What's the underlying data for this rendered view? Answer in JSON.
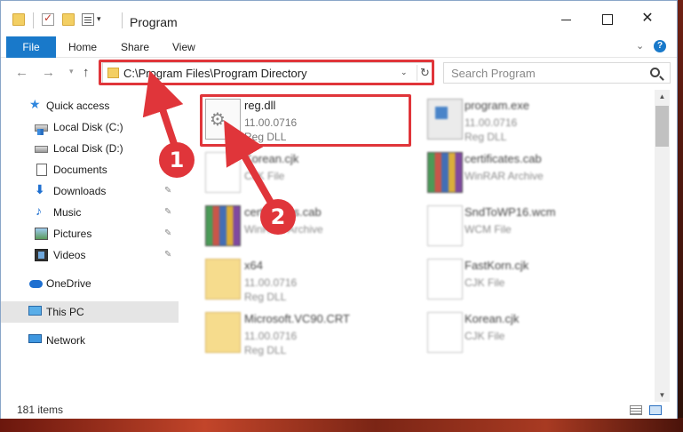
{
  "window": {
    "title": "Program",
    "minimize_glyph": "",
    "close_glyph": "✕"
  },
  "ribbon": {
    "tabs": [
      "File",
      "Home",
      "Share",
      "View"
    ],
    "collapse_glyph": "⌄",
    "help_glyph": "?"
  },
  "nav": {
    "back_glyph": "←",
    "forward_glyph": "→",
    "up_glyph": "↑",
    "recent_glyph": "▾"
  },
  "address": {
    "path": "C:\\Program Files\\Program Directory",
    "dropdown_glyph": "⌄",
    "refresh_glyph": "↻"
  },
  "search": {
    "placeholder": "Search Program"
  },
  "sidebar": {
    "items": [
      {
        "label": "Quick access",
        "icon": "star-icon"
      },
      {
        "label": "Local Disk (C:)",
        "icon": "drive-icon"
      },
      {
        "label": "Local Disk (D:)",
        "icon": "drive-icon"
      },
      {
        "label": "Documents",
        "icon": "documents-icon"
      },
      {
        "label": "Downloads",
        "icon": "download-icon"
      },
      {
        "label": "Music",
        "icon": "music-icon"
      },
      {
        "label": "Pictures",
        "icon": "pictures-icon"
      },
      {
        "label": "Videos",
        "icon": "videos-icon"
      },
      {
        "label": "OneDrive",
        "icon": "cloud-icon"
      },
      {
        "label": "This PC",
        "icon": "computer-icon"
      },
      {
        "label": "Network",
        "icon": "network-icon"
      }
    ],
    "pin_glyph": "📌"
  },
  "files": [
    {
      "name": "reg.dll",
      "meta1": "11.00.0716",
      "meta2": "Reg DLL"
    },
    {
      "name": "program.exe",
      "meta1": "11.00.0716",
      "meta2": "Reg DLL"
    },
    {
      "name": "Korean.cjk",
      "meta1": "CJK File",
      "meta2": ""
    },
    {
      "name": "certificates.cab",
      "meta1": "WinRAR Archive",
      "meta2": ""
    },
    {
      "name": "certificates.cab",
      "meta1": "WinRAR Archive",
      "meta2": ""
    },
    {
      "name": "SndToWP16.wcm",
      "meta1": "WCM File",
      "meta2": ""
    },
    {
      "name": "x64",
      "meta1": "11.00.0716",
      "meta2": "Reg DLL"
    },
    {
      "name": "FastKorn.cjk",
      "meta1": "CJK File",
      "meta2": ""
    },
    {
      "name": "Microsoft.VC90.CRT",
      "meta1": "11.00.0716",
      "meta2": "Reg DLL"
    },
    {
      "name": "Korean.cjk",
      "meta1": "CJK File",
      "meta2": ""
    }
  ],
  "status": {
    "item_count": "181 items"
  },
  "annotations": {
    "step1": "1",
    "step2": "2",
    "highlight_color": "#e0353a"
  },
  "colors": {
    "accent": "#1979ca",
    "selected_bg": "#e5e5e5"
  }
}
